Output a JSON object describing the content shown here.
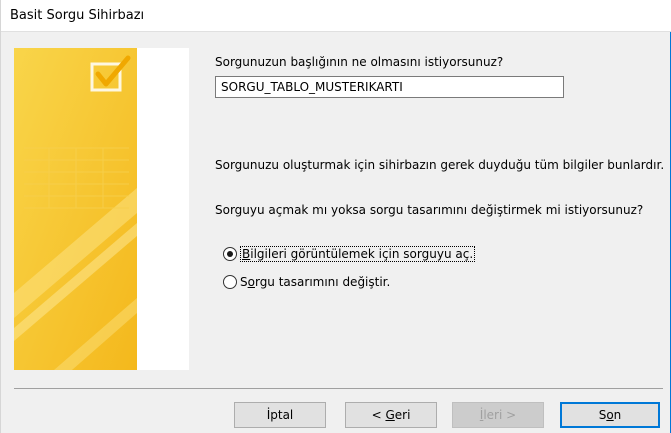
{
  "window": {
    "title": "Basit Sorgu Sihirbazı"
  },
  "question_title": "Sorgunuzun başlığının ne olmasını istiyorsunuz?",
  "query_title_value": "SORGU_TABLO_MUSTERIKARTI",
  "info_text": "Sorgunuzu oluşturmak için sihirbazın gerek duyduğu tüm bilgiler bunlardır.",
  "question_action": "Sorguyu açmak mı yoksa sorgu tasarımını değiştirmek mi istiyorsunuz?",
  "options": [
    {
      "hotkey": "B",
      "rest": "ilgileri görüntülemek için sorguyu aç.",
      "checked": true
    },
    {
      "prefix": "S",
      "hotkey": "o",
      "rest": "rgu tasarımını değiştir.",
      "checked": false
    }
  ],
  "buttons": {
    "cancel": {
      "label": "İptal"
    },
    "back": {
      "prefix": "< ",
      "hotkey": "G",
      "rest": "eri"
    },
    "next": {
      "label": "İleri >",
      "hotkey": "İ",
      "rest": "leri >"
    },
    "finish": {
      "prefix": "S",
      "hotkey": "o",
      "rest": "n"
    }
  },
  "colors": {
    "accent": "#0078d7",
    "art_yellow": "#f6c41a",
    "art_light": "#fbe27a"
  }
}
